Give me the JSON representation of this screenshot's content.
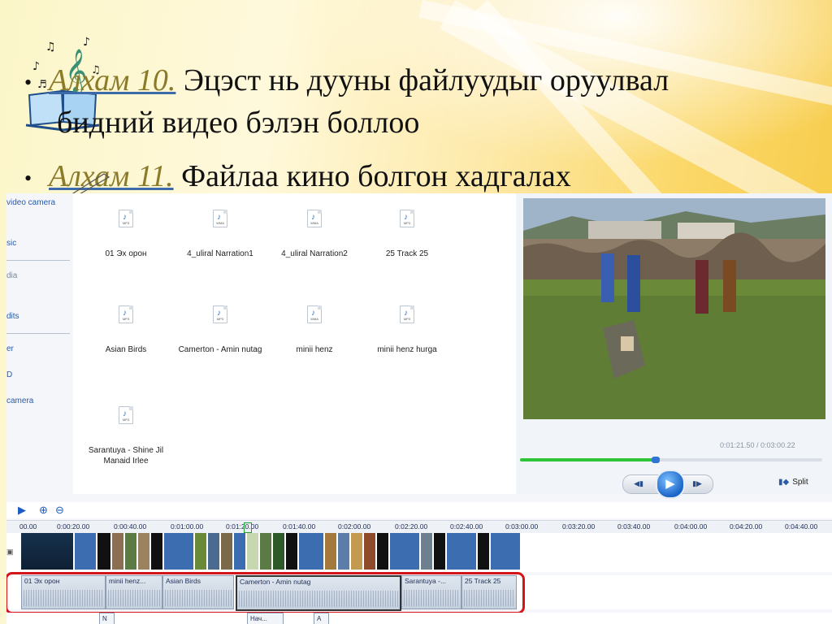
{
  "slide": {
    "bullet1": {
      "step": "Алхам 10.",
      "text": "Эцэст нь дууны файлуудыг оруулвал",
      "continuation": "бидний видео бэлэн боллоо"
    },
    "bullet2": {
      "step": "Алхам 11.",
      "text": "Файлаа кино болгон хадгалах"
    }
  },
  "nav": {
    "items": [
      "video camera",
      "sic",
      "dia",
      "dits",
      "er",
      "D",
      "camera"
    ]
  },
  "files": [
    {
      "name": "01 Эх орон",
      "ext": "MP3"
    },
    {
      "name": "4_uliral Narration1",
      "ext": "WMA"
    },
    {
      "name": "4_uliral Narration2",
      "ext": "WMA"
    },
    {
      "name": "25 Track 25",
      "ext": "MP3"
    },
    {
      "name": "Asian Birds",
      "ext": "MP3"
    },
    {
      "name": "Camerton - Amin nutag",
      "ext": "MP3"
    },
    {
      "name": "minii henz",
      "ext": "WMA"
    },
    {
      "name": "minii henz hurga",
      "ext": "MP3"
    },
    {
      "name": "Sarantuya - Shine Jil Manaid Irlee",
      "ext": "MP3"
    }
  ],
  "preview": {
    "time": "0:01:21.50 / 0:03:00.22",
    "progress": 0.45,
    "split_label": "Split"
  },
  "timeline": {
    "ticks": [
      "00.00",
      "0:00:20.00",
      "0:00:40.00",
      "0:01:00.00",
      "0:01:20.00",
      "0:01:40.00",
      "0:02:00.00",
      "0:02:20.00",
      "0:02:40.00",
      "0:03:00.00",
      "0:03:20.00",
      "0:03:40.00",
      "0:04:00.00",
      "0:04:20.00",
      "0:04:40.00"
    ],
    "audio_clips": [
      "01 Эх орон",
      "minii henz...",
      "Asian Birds",
      "Camerton - Amin nutag",
      "Sarantuya -...",
      "25 Track 25"
    ],
    "captions": [
      "N",
      "Нач...",
      "A"
    ]
  }
}
